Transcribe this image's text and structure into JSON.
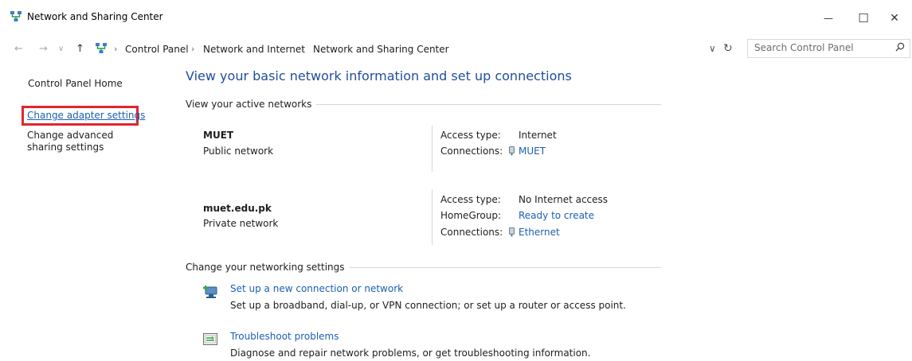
{
  "window": {
    "title": "Network and Sharing Center",
    "controls": {
      "minimize": "—",
      "maximize": "☐",
      "close": "✕"
    }
  },
  "address_bar": {
    "back": "←",
    "forward": "→",
    "recent": "∨",
    "up": "↑",
    "breadcrumbs": [
      "Control Panel",
      "Network and Internet",
      "Network and Sharing Center"
    ],
    "separator": "›",
    "dropdown": "∨",
    "refresh": "↻"
  },
  "search": {
    "placeholder": "Search Control Panel",
    "value": ""
  },
  "sidebar": {
    "home": "Control Panel Home",
    "change_adapter": "Change adapter settings",
    "change_advanced": "Change advanced sharing settings",
    "highlight_color": "#e0262f"
  },
  "main": {
    "heading": "View your basic network information and set up connections",
    "active_networks_label": "View your active networks",
    "networks": [
      {
        "name": "MUET",
        "type": "Public network",
        "details": [
          {
            "key": "Access type:",
            "value": "Internet",
            "is_link": false
          },
          {
            "key": "Connections:",
            "value": "MUET",
            "is_link": true,
            "icon": "wifi-adapter-icon"
          }
        ]
      },
      {
        "name": "muet.edu.pk",
        "type": "Private network",
        "details": [
          {
            "key": "Access type:",
            "value": "No Internet access",
            "is_link": false
          },
          {
            "key": "HomeGroup:",
            "value": "Ready to create",
            "is_link": true
          },
          {
            "key": "Connections:",
            "value": "Ethernet",
            "is_link": true,
            "icon": "ethernet-adapter-icon"
          }
        ]
      }
    ],
    "change_settings_label": "Change your networking settings",
    "tasks": [
      {
        "title": "Set up a new connection or network",
        "description": "Set up a broadband, dial-up, or VPN connection; or set up a router or access point.",
        "icon": "new-connection-icon"
      },
      {
        "title": "Troubleshoot problems",
        "description": "Diagnose and repair network problems, or get troubleshooting information.",
        "icon": "troubleshoot-icon"
      }
    ]
  },
  "colors": {
    "link": "#1a5fb4",
    "heading": "#1f4e9a",
    "divider": "#d7d7d7"
  }
}
